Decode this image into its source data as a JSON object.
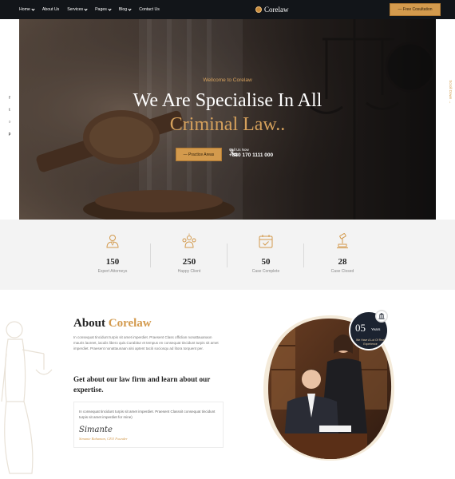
{
  "nav": {
    "items": [
      {
        "label": "Home",
        "dropdown": true
      },
      {
        "label": "About Us",
        "dropdown": false
      },
      {
        "label": "Services",
        "dropdown": true
      },
      {
        "label": "Pages",
        "dropdown": true
      },
      {
        "label": "Blog",
        "dropdown": true
      },
      {
        "label": "Contact Us",
        "dropdown": false
      }
    ],
    "brand": "Corelaw",
    "cta_label": "— Free Cosultation"
  },
  "hero": {
    "welcome": "Wellcome to Corelaw",
    "title_line1": "We Are Specialise In All",
    "title_line2": "Criminal Law..",
    "button_label": "— Practice Areas",
    "call_label": "Call Us Now",
    "call_number": "+880 170 1111 000",
    "scroll_label": "Scroll Down →"
  },
  "social": {
    "icons": [
      "facebook-icon",
      "twitter-icon",
      "instagram-icon",
      "pinterest-icon"
    ],
    "glyphs": [
      "f",
      "t",
      "○",
      "p"
    ]
  },
  "stats": [
    {
      "value": "150",
      "label": "Expert Attorneys",
      "icon": "attorney-icon"
    },
    {
      "value": "250",
      "label": "Happy Client",
      "icon": "happy-client-icon"
    },
    {
      "value": "50",
      "label": "Case Complete",
      "icon": "calendar-check-icon"
    },
    {
      "value": "28",
      "label": "Case Closed",
      "icon": "gavel-icon"
    }
  ],
  "about": {
    "title_plain": "About ",
    "title_accent": "Corelaw",
    "paragraph": "In consequat tincidunt turpis sit amet imperdiet. Praesent Class officlian nonattauanaon mauris laoreet, iaculis libero quis.Curabitur et tempus en consequat tincidunt turpis sit amet imperdiet. Praesent nonattaunaan alsi aptent taciti sociosqu ad litora torquent per.",
    "subtitle": "Get about our law firm and learn about our expertise.",
    "quote": "In consequat tincidunt turpis sit amet imperdiet. Praesent Classsit consequat tincidunt turpis sit amet imperdiet for mine)",
    "signature": "Simante",
    "signer": "Simante Rahaman, CEO Founder",
    "years_number": "05",
    "years_word": "Years",
    "years_text": "We Have A Lot Of Real Experience"
  },
  "colors": {
    "accent": "#d39a4d",
    "dark": "#121519",
    "stats_bg": "#f3f3f3"
  }
}
